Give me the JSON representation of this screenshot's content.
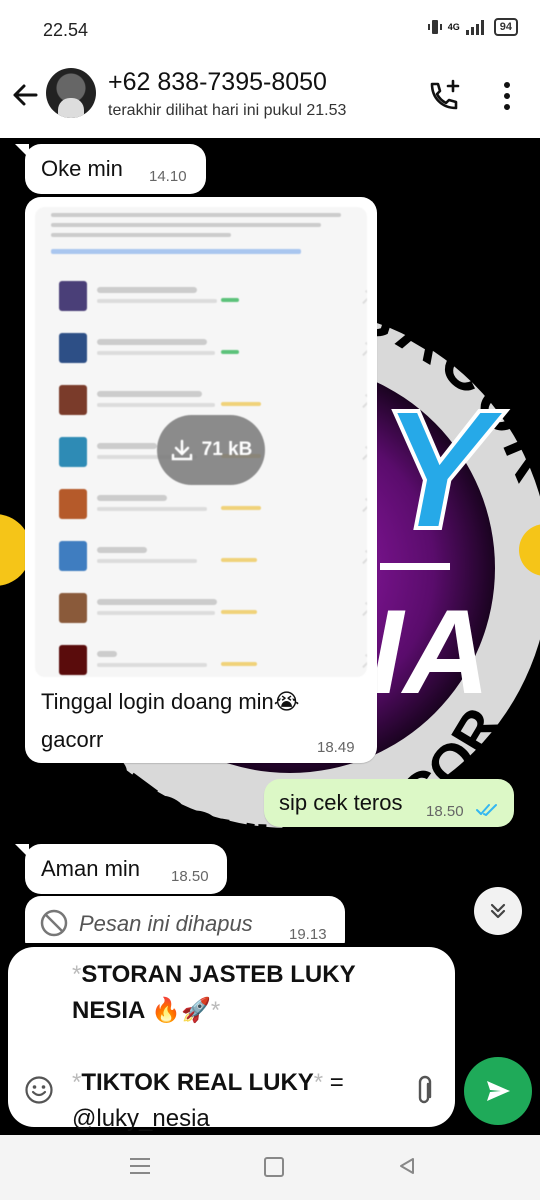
{
  "status_bar": {
    "time": "22.54",
    "network": "4G",
    "battery": "94"
  },
  "header": {
    "contact_name": "+62 838-7395-8050",
    "last_seen": "terakhir dilihat hari ini pukul 21.53"
  },
  "messages": [
    {
      "type": "text",
      "direction": "in",
      "text": "Oke min",
      "time": "14.10"
    },
    {
      "type": "image",
      "direction": "in",
      "download_size": "71 kB",
      "caption_line1": "Tinggal login doang min😭",
      "caption_line2": "gacorr",
      "time": "18.49"
    },
    {
      "type": "text",
      "direction": "out",
      "text": "sip cek teros",
      "time": "18.50",
      "read": true
    },
    {
      "type": "text",
      "direction": "in",
      "text": "Aman min",
      "time": "18.50"
    },
    {
      "type": "deleted",
      "direction": "in",
      "text": "Pesan ini dihapus",
      "time": "19.13"
    }
  ],
  "wallpaper_text": {
    "top_arc": "T GACOR",
    "bottom_arc": "RESSULT GACOR",
    "center_top": "Y",
    "center_bottom": "IA"
  },
  "composer": {
    "star": "*",
    "bold_1": "STORAN JASTEB LUKY NESIA 🔥🚀",
    "bold_2": "TIKTOK REAL LUKY",
    "suffix_2": " =",
    "line_3": "@luky_nesia"
  },
  "colors": {
    "accent": "#1faa59",
    "outgoing_bubble": "#dcf8c6",
    "read_ticks": "#34b7f1"
  }
}
